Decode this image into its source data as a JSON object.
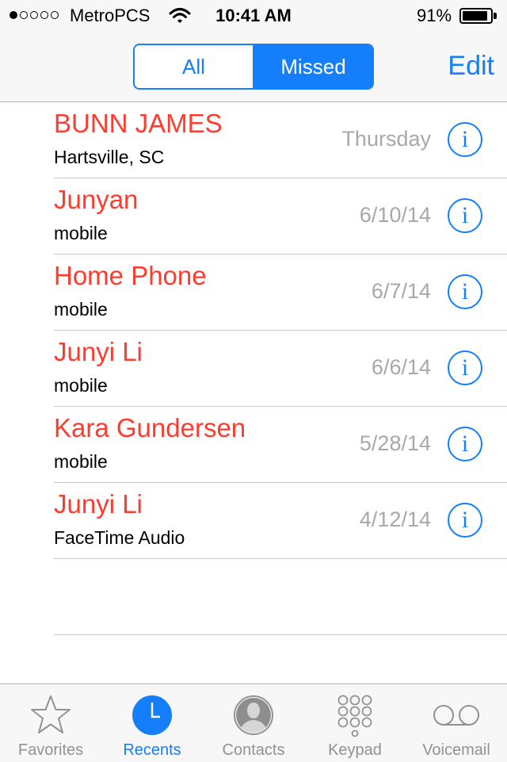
{
  "status_bar": {
    "signal_bars_filled": 1,
    "signal_bars_total": 5,
    "carrier": "MetroPCS",
    "time": "10:41 AM",
    "battery_percent": "91%",
    "battery_level": 0.91
  },
  "nav": {
    "segments": [
      "All",
      "Missed"
    ],
    "selected_segment": "Missed",
    "edit_label": "Edit"
  },
  "calls": [
    {
      "name": "BUNN JAMES",
      "detail": "Hartsville, SC",
      "date": "Thursday"
    },
    {
      "name": "Junyan",
      "detail": "mobile",
      "date": "6/10/14"
    },
    {
      "name": "Home Phone",
      "detail": "mobile",
      "date": "6/7/14"
    },
    {
      "name": "Junyi Li",
      "detail": "mobile",
      "date": "6/6/14"
    },
    {
      "name": "Kara Gundersen",
      "detail": "mobile",
      "date": "5/28/14"
    },
    {
      "name": "Junyi Li",
      "detail": "FaceTime Audio",
      "date": "4/12/14"
    }
  ],
  "info_glyph": "i",
  "tabs": [
    {
      "label": "Favorites",
      "icon": "star-icon"
    },
    {
      "label": "Recents",
      "icon": "clock-icon",
      "active": true
    },
    {
      "label": "Contacts",
      "icon": "person-icon"
    },
    {
      "label": "Keypad",
      "icon": "keypad-icon"
    },
    {
      "label": "Voicemail",
      "icon": "voicemail-icon"
    }
  ],
  "colors": {
    "accent": "#157efb",
    "missed_call": "#ff3b30",
    "date_gray": "#a8a8a8",
    "tab_inactive": "#929292"
  }
}
